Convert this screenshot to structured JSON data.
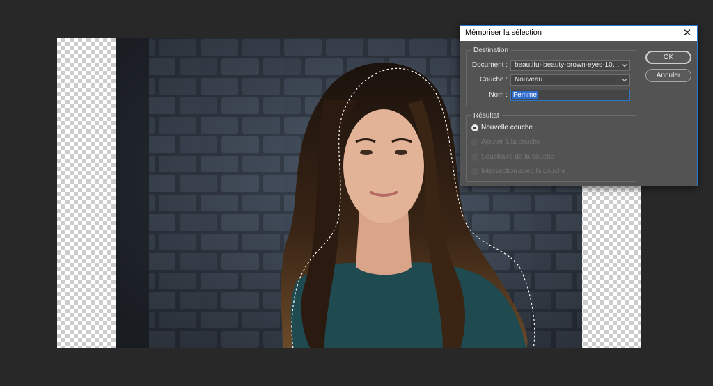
{
  "dialog": {
    "title": "Mémoriser la sélection",
    "close_glyph": "✕",
    "destination": {
      "legend": "Destination",
      "document_label": "Document :",
      "document_value": "beautiful-beauty-brown-eyes-1065...",
      "channel_label": "Couche :",
      "channel_value": "Nouveau",
      "name_label": "Nom :",
      "name_value": "Femme"
    },
    "result": {
      "legend": "Résultat",
      "options": [
        {
          "label": "Nouvelle couche",
          "selected": true,
          "enabled": true
        },
        {
          "label": "Ajouter à la couche",
          "selected": false,
          "enabled": false
        },
        {
          "label": "Soustraire de la couche",
          "selected": false,
          "enabled": false
        },
        {
          "label": "Intersection avec la couche",
          "selected": false,
          "enabled": false
        }
      ]
    },
    "buttons": {
      "ok": "OK",
      "cancel": "Annuler"
    }
  },
  "colors": {
    "workspace": "#282828",
    "dialog_bg": "#535353",
    "accent": "#2a78c9"
  },
  "icons": [
    "close-icon",
    "chevron-down-icon"
  ]
}
